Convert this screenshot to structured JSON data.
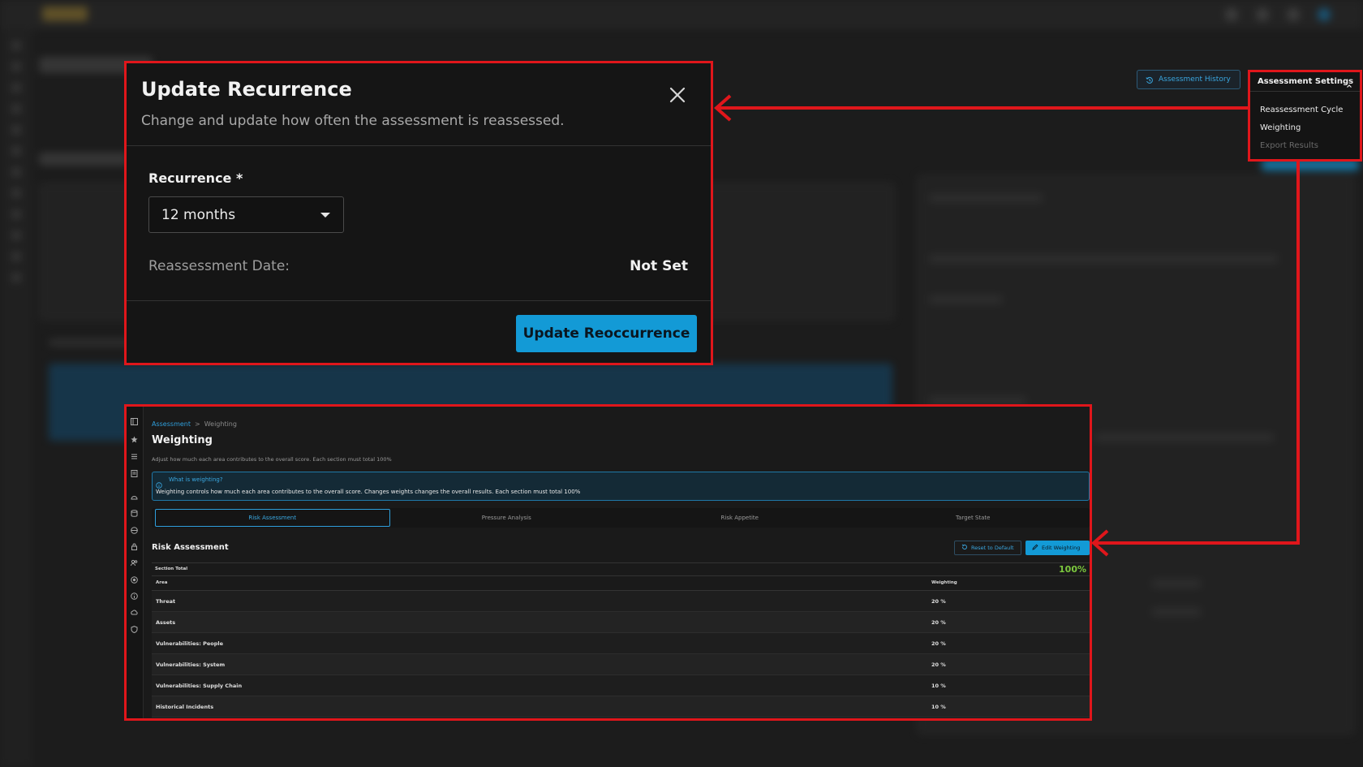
{
  "modal": {
    "title": "Update Recurrence",
    "subtitle": "Change and update how often the assessment is reassessed.",
    "recurrence_label": "Recurrence *",
    "recurrence_value": "12 months",
    "reassessment_date_label": "Reassessment Date:",
    "reassessment_date_value": "Not Set",
    "submit_label": "Update Reoccurrence"
  },
  "header": {
    "history_label": "Assessment History"
  },
  "settings_menu": {
    "title": "Assessment Settings",
    "items": [
      {
        "label": "Reassessment Cycle",
        "enabled": true
      },
      {
        "label": "Weighting",
        "enabled": true
      },
      {
        "label": "Export Results",
        "enabled": false
      }
    ]
  },
  "weighting": {
    "breadcrumb": {
      "parent": "Assessment",
      "separator": ">",
      "current": "Weighting"
    },
    "title": "Weighting",
    "description": "Adjust how much each area contributes to the overall score. Each section must total 100%",
    "info_title": "What is weighting?",
    "info_text": "Weighting controls how much each area contributes to the overall score. Changes weights changes the overall results. Each section must total 100%",
    "tabs": [
      "Risk Assessment",
      "Pressure Analysis",
      "Risk Appetite",
      "Target State"
    ],
    "active_tab": "Risk Assessment",
    "section_title": "Risk Assessment",
    "reset_label": "Reset to Default",
    "edit_label": "Edit Weighting",
    "section_total_label": "Section Total",
    "section_total_value": "100%",
    "columns": [
      "Area",
      "Weighting"
    ],
    "rows": [
      {
        "area": "Threat",
        "weight": "20 %"
      },
      {
        "area": "Assets",
        "weight": "20 %"
      },
      {
        "area": "Vulnerabilities: People",
        "weight": "20 %"
      },
      {
        "area": "Vulnerabilities: System",
        "weight": "20 %"
      },
      {
        "area": "Vulnerabilities: Supply Chain",
        "weight": "10 %"
      },
      {
        "area": "Historical Incidents",
        "weight": "10 %"
      }
    ]
  },
  "colors": {
    "highlight": "#e0161b",
    "accent": "#139ad6",
    "success": "#7cc83e"
  }
}
